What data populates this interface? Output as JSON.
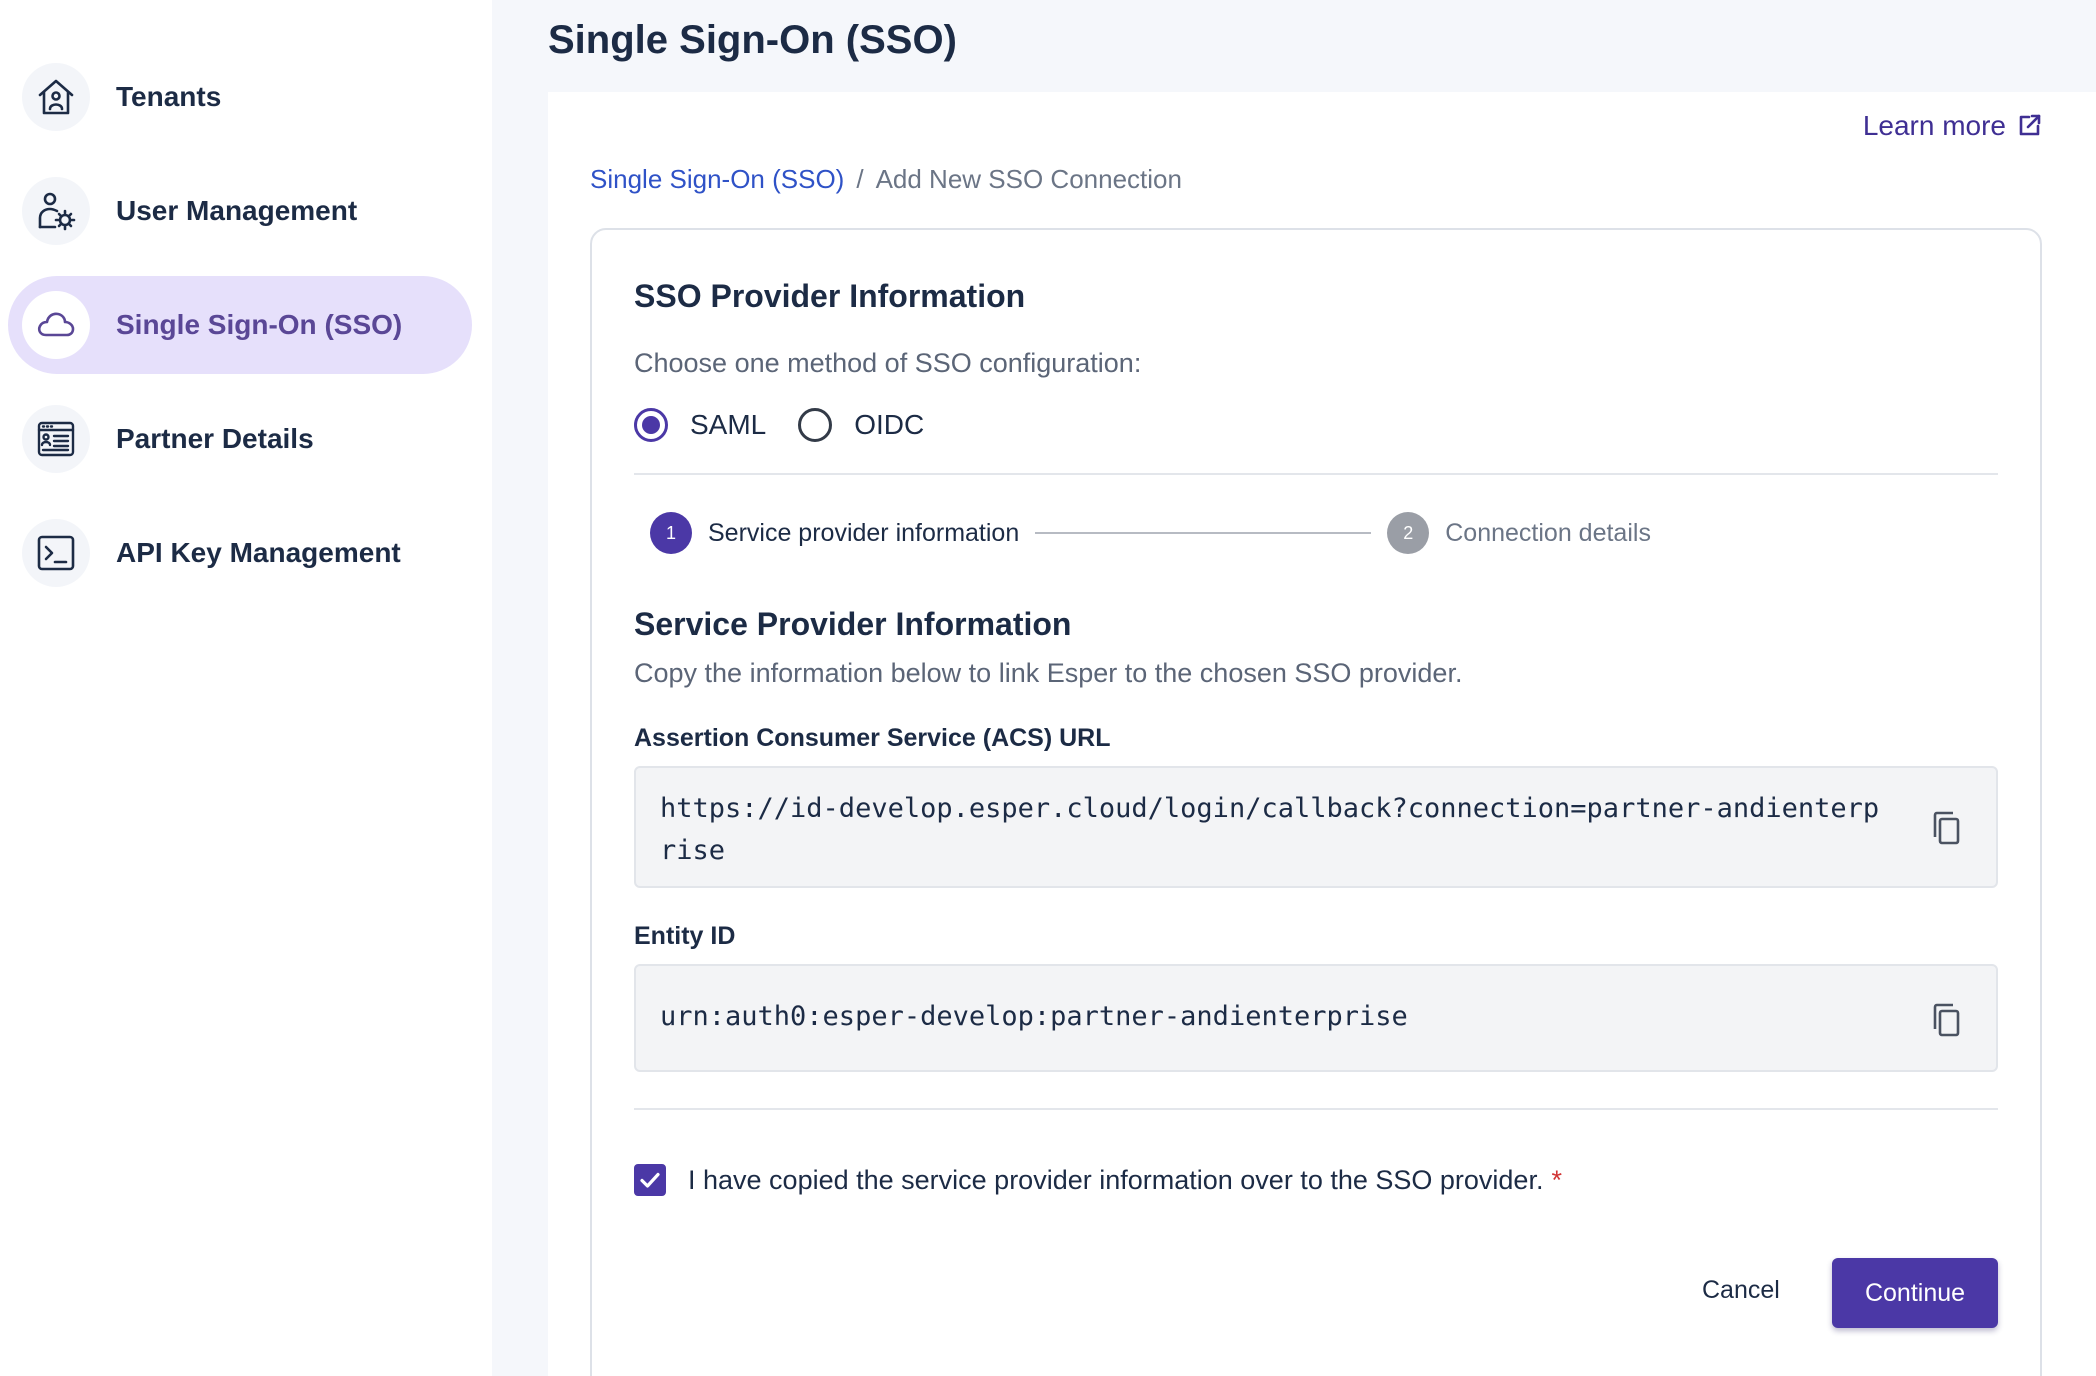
{
  "sidebar": {
    "items": [
      {
        "label": "Tenants",
        "icon": "house-user-icon",
        "active": false
      },
      {
        "label": "User Management",
        "icon": "user-gear-icon",
        "active": false
      },
      {
        "label": "Single Sign-On (SSO)",
        "icon": "cloud-icon",
        "active": true
      },
      {
        "label": "Partner Details",
        "icon": "id-card-list-icon",
        "active": false
      },
      {
        "label": "API Key Management",
        "icon": "terminal-icon",
        "active": false
      }
    ]
  },
  "header": {
    "title": "Single Sign-On (SSO)",
    "learn_more": "Learn more"
  },
  "breadcrumb": {
    "link": "Single Sign-On (SSO)",
    "separator": "/",
    "current": "Add New SSO Connection"
  },
  "card": {
    "title": "SSO Provider Information",
    "method_prompt": "Choose one method of SSO configuration:",
    "methods": [
      {
        "label": "SAML",
        "selected": true
      },
      {
        "label": "OIDC",
        "selected": false
      }
    ],
    "steps": [
      {
        "number": "1",
        "label": "Service provider information",
        "active": true
      },
      {
        "number": "2",
        "label": "Connection details",
        "active": false
      }
    ],
    "section_title": "Service Provider Information",
    "section_desc": "Copy the information below to link Esper to the chosen SSO provider.",
    "acs": {
      "label": "Assertion Consumer Service (ACS) URL",
      "value": "https://id-develop.esper.cloud/login/callback?connection=partner-andienterprise"
    },
    "entity": {
      "label": "Entity ID",
      "value": "urn:auth0:esper-develop:partner-andienterprise"
    },
    "confirm": {
      "label": "I have copied the service provider information over to the SSO provider.",
      "required_mark": "*",
      "checked": true
    },
    "actions": {
      "cancel": "Cancel",
      "continue": "Continue"
    }
  },
  "colors": {
    "primary": "#4b38a6",
    "active_nav_bg": "#e6e0fb",
    "link": "#2f52c7",
    "required": "#d13434"
  }
}
